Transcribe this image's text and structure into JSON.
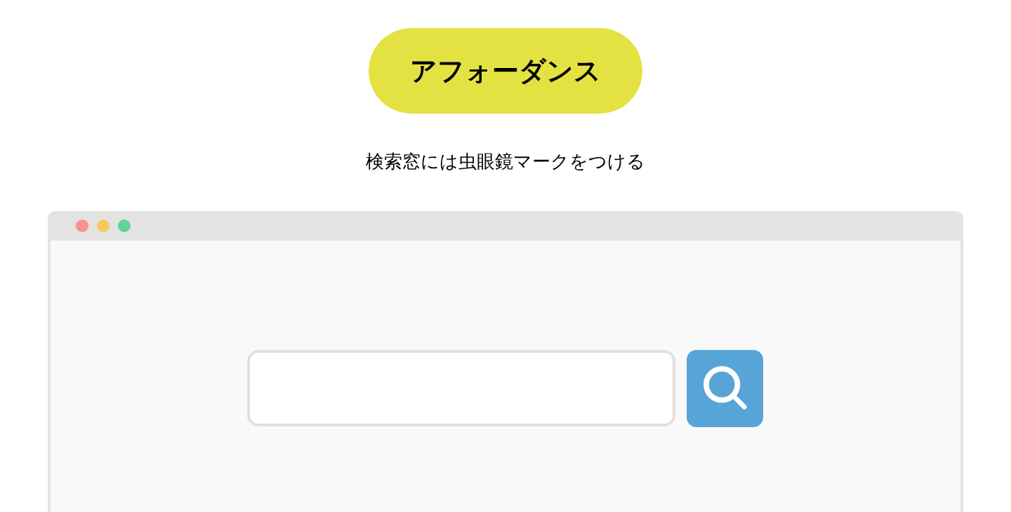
{
  "title_badge": {
    "label": "アフォーダンス"
  },
  "caption": "検索窓には虫眼鏡マークをつける",
  "browser_window": {
    "controls": [
      {
        "color": "#fd8f8f"
      },
      {
        "color": "#f7c95a"
      },
      {
        "color": "#5dd598"
      }
    ]
  }
}
